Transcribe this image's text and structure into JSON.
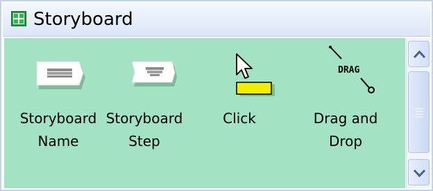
{
  "window": {
    "title": "Storyboard",
    "title_icon": "storyboard-grid-icon"
  },
  "palette": [
    {
      "id": "storyboard-name",
      "icon": "storyboard-name-icon",
      "label_line1": "Storyboard",
      "label_line2": "Name"
    },
    {
      "id": "storyboard-step",
      "icon": "storyboard-step-icon",
      "label_line1": "Storyboard",
      "label_line2": "Step"
    },
    {
      "id": "click",
      "icon": "click-cursor-icon",
      "label_line1": "Click",
      "label_line2": ""
    },
    {
      "id": "drag-and-drop",
      "icon": "drag-and-drop-icon",
      "label_line1": "Drag and",
      "label_line2": "Drop",
      "icon_text": "DRAG"
    }
  ],
  "scrollbar": {
    "up_icon": "chevron-up-icon",
    "down_icon": "chevron-down-icon",
    "thumb_icon": "grip-lines-icon"
  },
  "colors": {
    "content_background": "#a3e2c3",
    "title_background": "#e6eefb",
    "click_highlight": "#f2ee00"
  }
}
